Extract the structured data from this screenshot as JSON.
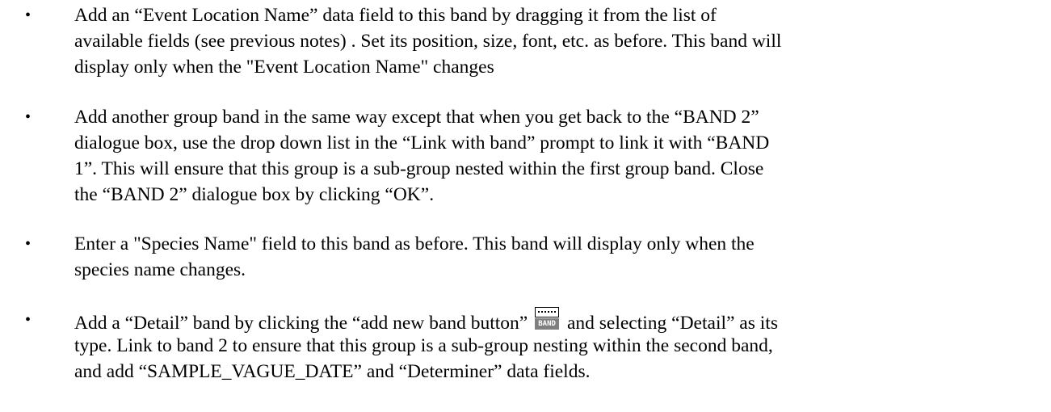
{
  "bullet_glyph": "•",
  "items": [
    {
      "lines": [
        "Add an “Event Location Name” data field to this band by dragging it from the list of",
        "available fields (see previous notes) . Set its position, size, font, etc. as before. This band will",
        "display only when the \"Event Location Name\" changes"
      ]
    },
    {
      "lines": [
        "Add another group band in the same way except that when you get back to the “BAND 2”",
        "dialogue box, use the drop down list in the “Link with band” prompt to link it with “BAND",
        "1”. This will ensure that this group is a sub-group nested within the first group band. Close",
        "the “BAND 2” dialogue box by clicking “OK”."
      ]
    },
    {
      "lines": [
        "Enter a  \"Species Name\" field to this band as before. This band will display only when the",
        "species name changes."
      ]
    },
    {
      "line1_before_icon": "Add a “Detail” band by clicking the “add new band button” ",
      "line1_after_icon": " and selecting “Detail” as its",
      "band_icon_label": "BAND",
      "lines_after": [
        "type. Link to band 2 to ensure that this group is a sub-group nesting within the second band,",
        "and add “SAMPLE_VAGUE_DATE” and “Determiner” data fields."
      ]
    }
  ]
}
